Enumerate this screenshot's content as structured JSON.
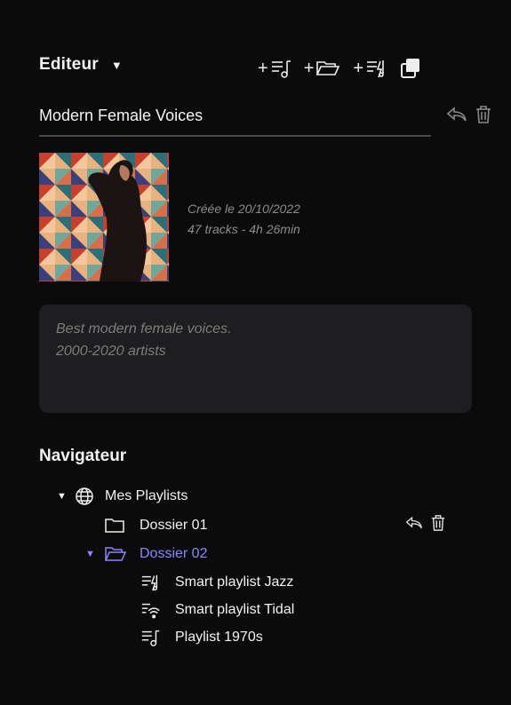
{
  "editor": {
    "title": "Editeur",
    "playlist_name": "Modern Female Voices",
    "created": "Créée le 20/10/2022",
    "stats": "47 tracks - 4h 26min",
    "description": [
      "Best modern female voices.",
      "2000-2020 artists"
    ],
    "toolbar_icons": [
      "add-playlist-icon",
      "add-folder-icon",
      "add-smart-playlist-icon",
      "duplicate-icon"
    ]
  },
  "navigator": {
    "title": "Navigateur",
    "root": "Mes Playlists",
    "folder1": "Dossier 01",
    "folder2": "Dossier 02",
    "items": [
      "Smart playlist Jazz",
      "Smart playlist Tidal",
      "Playlist 1970s"
    ]
  },
  "colors": {
    "background": "#0b0b0c",
    "accent": "#8b87ff",
    "panel": "#1e1e20"
  }
}
